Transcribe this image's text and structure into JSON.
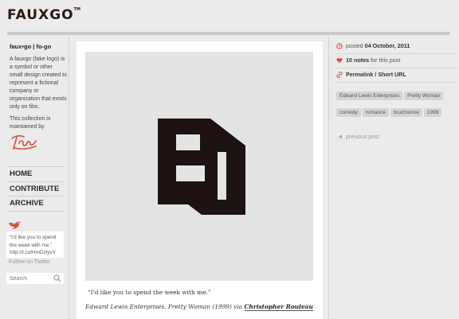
{
  "header": {
    "logo": "FAUXGO",
    "logo_tm": "TM"
  },
  "sidebar": {
    "site_name": "faux•go | fo-go",
    "description": "A fauxgo (fake logo) is a symbol or other small design created to represent a fictional company or organization that exists only on film.",
    "maintained_by": "This collection is maintained by",
    "signature": "Lynn",
    "nav": [
      {
        "label": "HOME"
      },
      {
        "label": "CONTRIBUTE"
      },
      {
        "label": "ARCHIVE"
      }
    ],
    "tweet_line1": "“I'd like you to spend",
    "tweet_line2": "the week with me.”",
    "tweet_line3": "http://t.co/HmDzlyvY",
    "follow": "Follow on Twitter",
    "search_placeholder": "Search"
  },
  "post": {
    "quote": "“I'd like you to spend the week with me.”",
    "caption_prefix": "Edward Lewis Enterprises, Pretty Woman (1999) via",
    "author": "Christopher Rouleau"
  },
  "meta": {
    "posted_label": "posted",
    "date": "04 October, 2011",
    "notes_count": "10 notes",
    "notes_suffix": "for this post",
    "permalink": "Permalink",
    "separator": "/",
    "short_url": "Short URL",
    "tags": [
      "Edward Lewis Enterprises",
      "Pretty Woman",
      "comedy",
      "romance",
      "touchstone",
      "1999"
    ],
    "previous": "previous post"
  },
  "colors": {
    "accent": "#d84b3f",
    "background": "#ebebeb",
    "logo_mark": "#1e1212"
  }
}
